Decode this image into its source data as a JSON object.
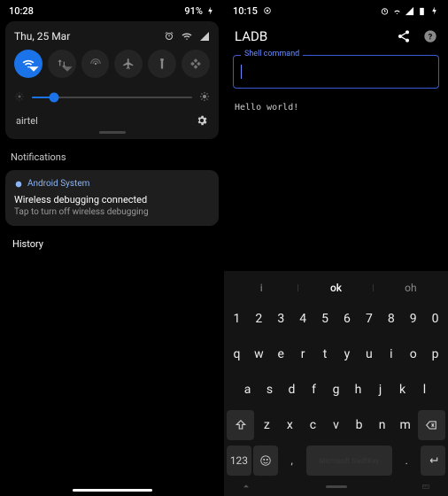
{
  "left": {
    "status": {
      "time": "10:28",
      "battery": "91%"
    },
    "qs": {
      "date": "Thu, 25 Mar",
      "carrier": "airtel"
    },
    "notif_header": "Notifications",
    "notif": {
      "app": "Android System",
      "title": "Wireless debugging connected",
      "text": "Tap to turn off wireless debugging"
    },
    "history": "History"
  },
  "right": {
    "status": {
      "time": "10:15"
    },
    "app_title": "LADB",
    "shell_label": "Shell command",
    "output": "Hello world!",
    "suggestions": {
      "left": "i",
      "mid": "ok",
      "right": "oh"
    },
    "num_row": [
      "1",
      "2",
      "3",
      "4",
      "5",
      "6",
      "7",
      "8",
      "9",
      "0"
    ],
    "row1": [
      "q",
      "w",
      "e",
      "r",
      "t",
      "y",
      "u",
      "i",
      "o",
      "p"
    ],
    "row2": [
      "a",
      "s",
      "d",
      "f",
      "g",
      "h",
      "j",
      "k",
      "l"
    ],
    "row3": [
      "z",
      "x",
      "c",
      "v",
      "b",
      "n",
      "m"
    ],
    "sym_key": "123",
    "comma": ",",
    "period": ".",
    "space_brand": "Microsoft SwiftKey"
  }
}
